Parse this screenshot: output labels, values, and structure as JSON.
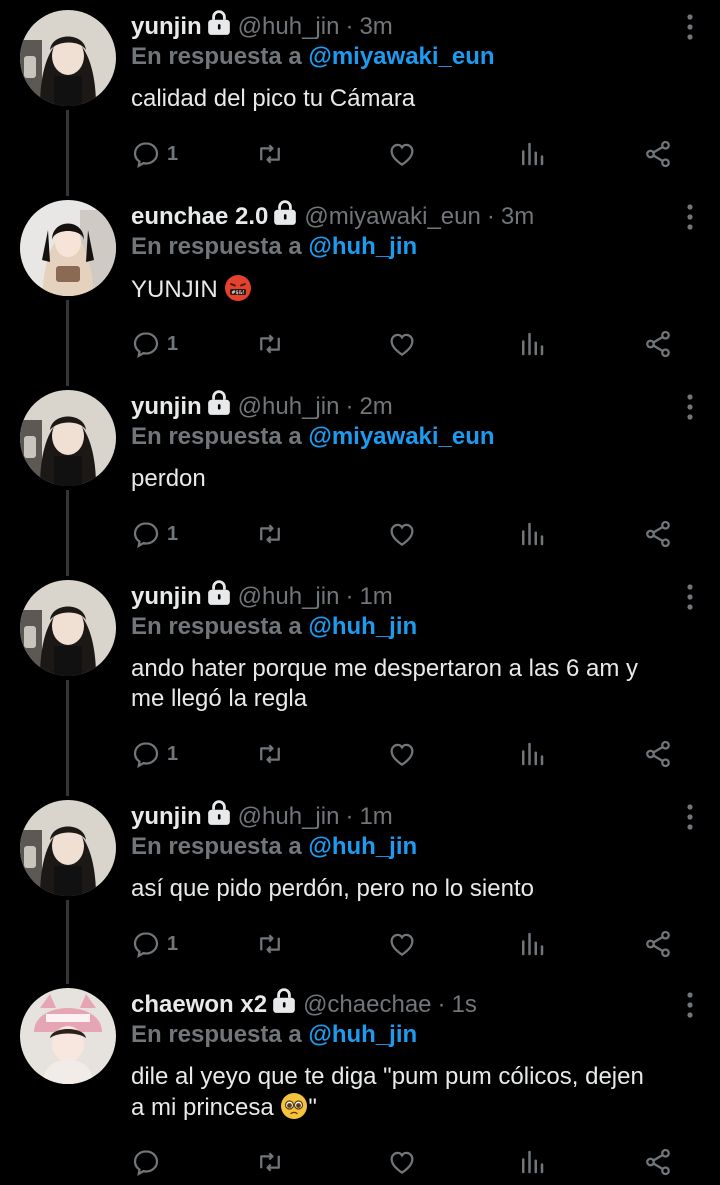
{
  "reply_prefix": "En respuesta a",
  "tweets": [
    {
      "name": "yunjin",
      "handle": "@huh_jin",
      "time": "3m",
      "reply_to": "@miyawaki_eun",
      "text": "calidad del pico tu Cámara",
      "replies": "1",
      "avatar": "yunjin"
    },
    {
      "name": "eunchae 2.0",
      "handle": "@miyawaki_eun",
      "time": "3m",
      "reply_to": "@huh_jin",
      "text": "YUNJIN",
      "emoji": "face-with-symbols-on-mouth",
      "replies": "1",
      "avatar": "eunchae"
    },
    {
      "name": "yunjin",
      "handle": "@huh_jin",
      "time": "2m",
      "reply_to": "@miyawaki_eun",
      "text": "perdon",
      "replies": "1",
      "avatar": "yunjin"
    },
    {
      "name": "yunjin",
      "handle": "@huh_jin",
      "time": "1m",
      "reply_to": "@huh_jin",
      "text_line1": "ando hater porque me despertaron a las 6 am y",
      "text_line2": "me llegó la regla",
      "replies": "1",
      "avatar": "yunjin"
    },
    {
      "name": "yunjin",
      "handle": "@huh_jin",
      "time": "1m",
      "reply_to": "@huh_jin",
      "text": "así que pido perdón, pero no lo siento",
      "replies": "1",
      "avatar": "yunjin"
    },
    {
      "name": "chaewon x2",
      "handle": "@chaechae",
      "time": "1s",
      "reply_to": "@huh_jin",
      "text_line1": "dile al yeyo que te diga \"pum pum cólicos, dejen",
      "text_line2": "a mi princesa",
      "text_line2_end": "\"",
      "emoji": "pleading-face",
      "replies": "",
      "avatar": "chaewon"
    }
  ],
  "icons": {
    "reply": "reply-icon",
    "retweet": "retweet-icon",
    "like": "heart-icon",
    "views": "analytics-icon",
    "share": "share-icon",
    "more": "more-vertical-icon",
    "lock": "lock-icon"
  },
  "colors": {
    "background": "#000000",
    "text": "#e7e9ea",
    "muted": "#71767b",
    "mention": "#1d9bf0",
    "thread_line": "#333639"
  }
}
